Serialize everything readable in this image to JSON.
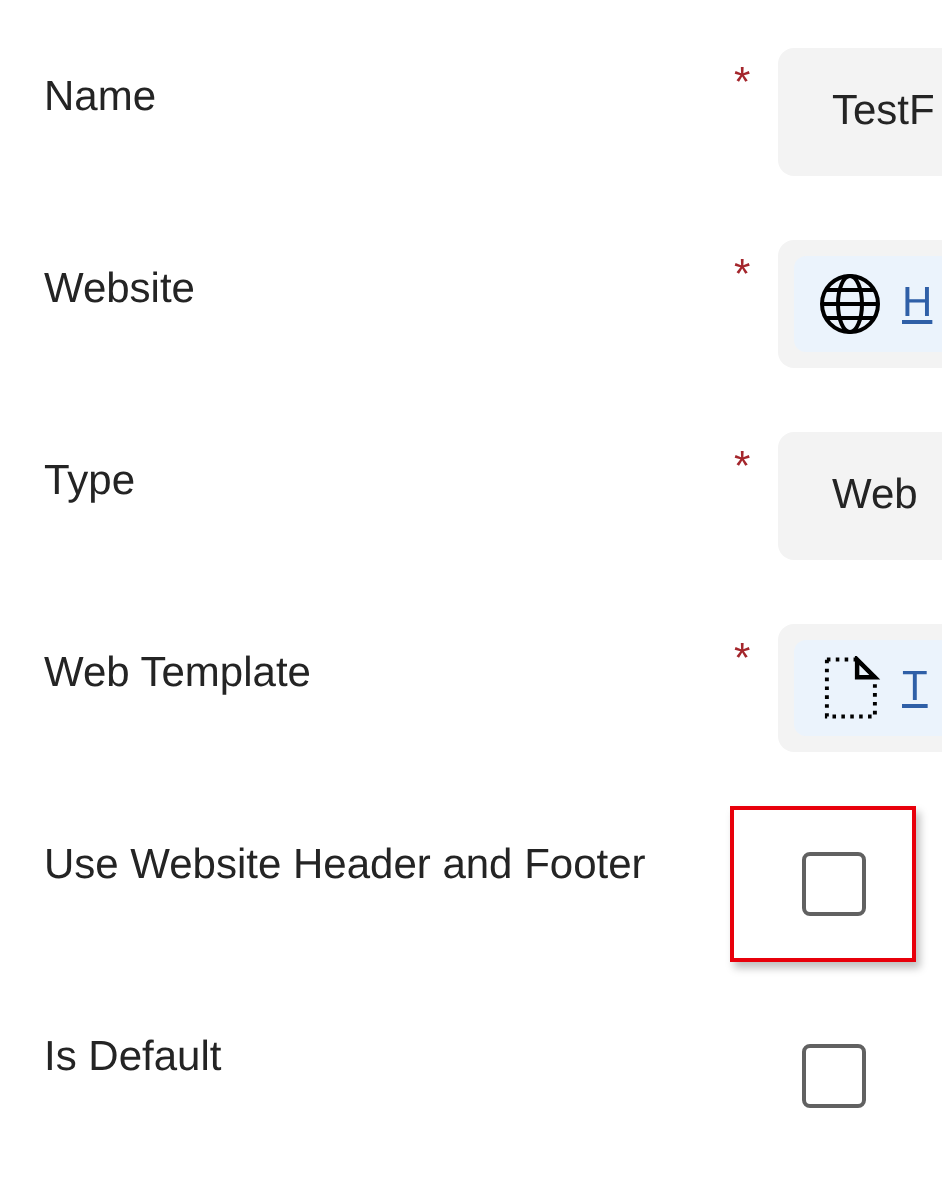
{
  "fields": [
    {
      "label": "Name",
      "kind": "text",
      "required_mark": "*",
      "value": "TestF"
    },
    {
      "label": "Website",
      "kind": "weblink",
      "required_mark": "*",
      "value": "H"
    },
    {
      "label": "Type",
      "kind": "text",
      "required_mark": "*",
      "value": "Web"
    },
    {
      "label": "Web Template",
      "kind": "filelink",
      "required_mark": "*",
      "value": "T"
    },
    {
      "label": "Use Website Header and Footer",
      "kind": "checkbox",
      "checked": false,
      "highlighted": true
    },
    {
      "label": "Is Default",
      "kind": "checkbox",
      "checked": false,
      "highlighted": false
    }
  ]
}
